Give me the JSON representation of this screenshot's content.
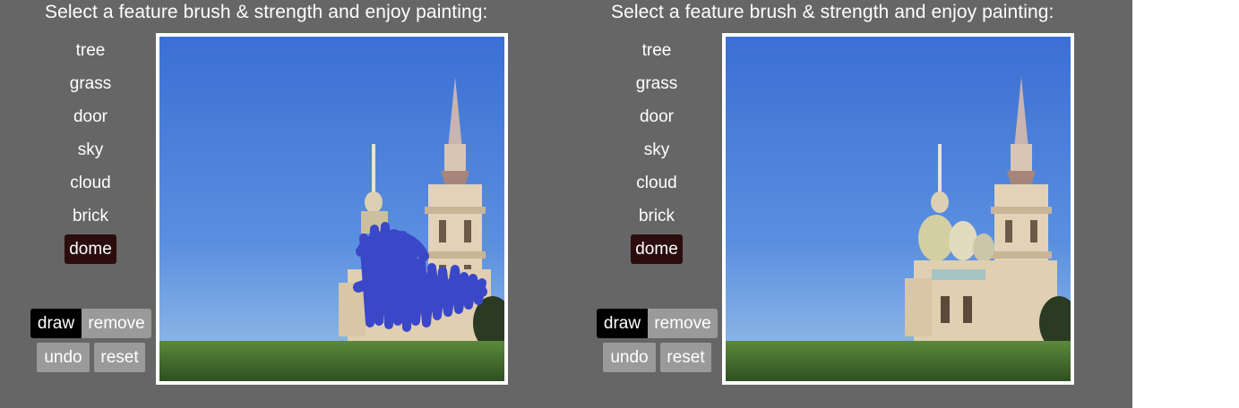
{
  "panels": [
    {
      "id": "input",
      "title": "Select a feature brush & strength and enjoy painting:",
      "brushes": [
        "tree",
        "grass",
        "door",
        "sky",
        "cloud",
        "brick",
        "dome"
      ],
      "selected_brush": "dome",
      "mode_buttons": {
        "draw": "draw",
        "remove": "remove"
      },
      "active_mode": "draw",
      "action_buttons": {
        "undo": "undo",
        "reset": "reset"
      },
      "canvas": {
        "content": "church-photo-with-blue-dome-scribble"
      }
    },
    {
      "id": "output",
      "title": "Select a feature brush & strength and enjoy painting:",
      "brushes": [
        "tree",
        "grass",
        "door",
        "sky",
        "cloud",
        "brick",
        "dome"
      ],
      "selected_brush": "dome",
      "mode_buttons": {
        "draw": "draw",
        "remove": "remove"
      },
      "active_mode": "draw",
      "action_buttons": {
        "undo": "undo",
        "reset": "reset"
      },
      "canvas": {
        "content": "church-photo-with-generated-domes"
      }
    }
  ],
  "colors": {
    "background": "#666666",
    "selected_brush": "#2b0d0d",
    "active_button": "#000000",
    "inactive_button": "#9a9a9a",
    "scribble": "#3b47c9",
    "sky_top": "#3b6fd4",
    "sky_bottom": "#9cc2e8",
    "grass": "#3f6b2c"
  }
}
